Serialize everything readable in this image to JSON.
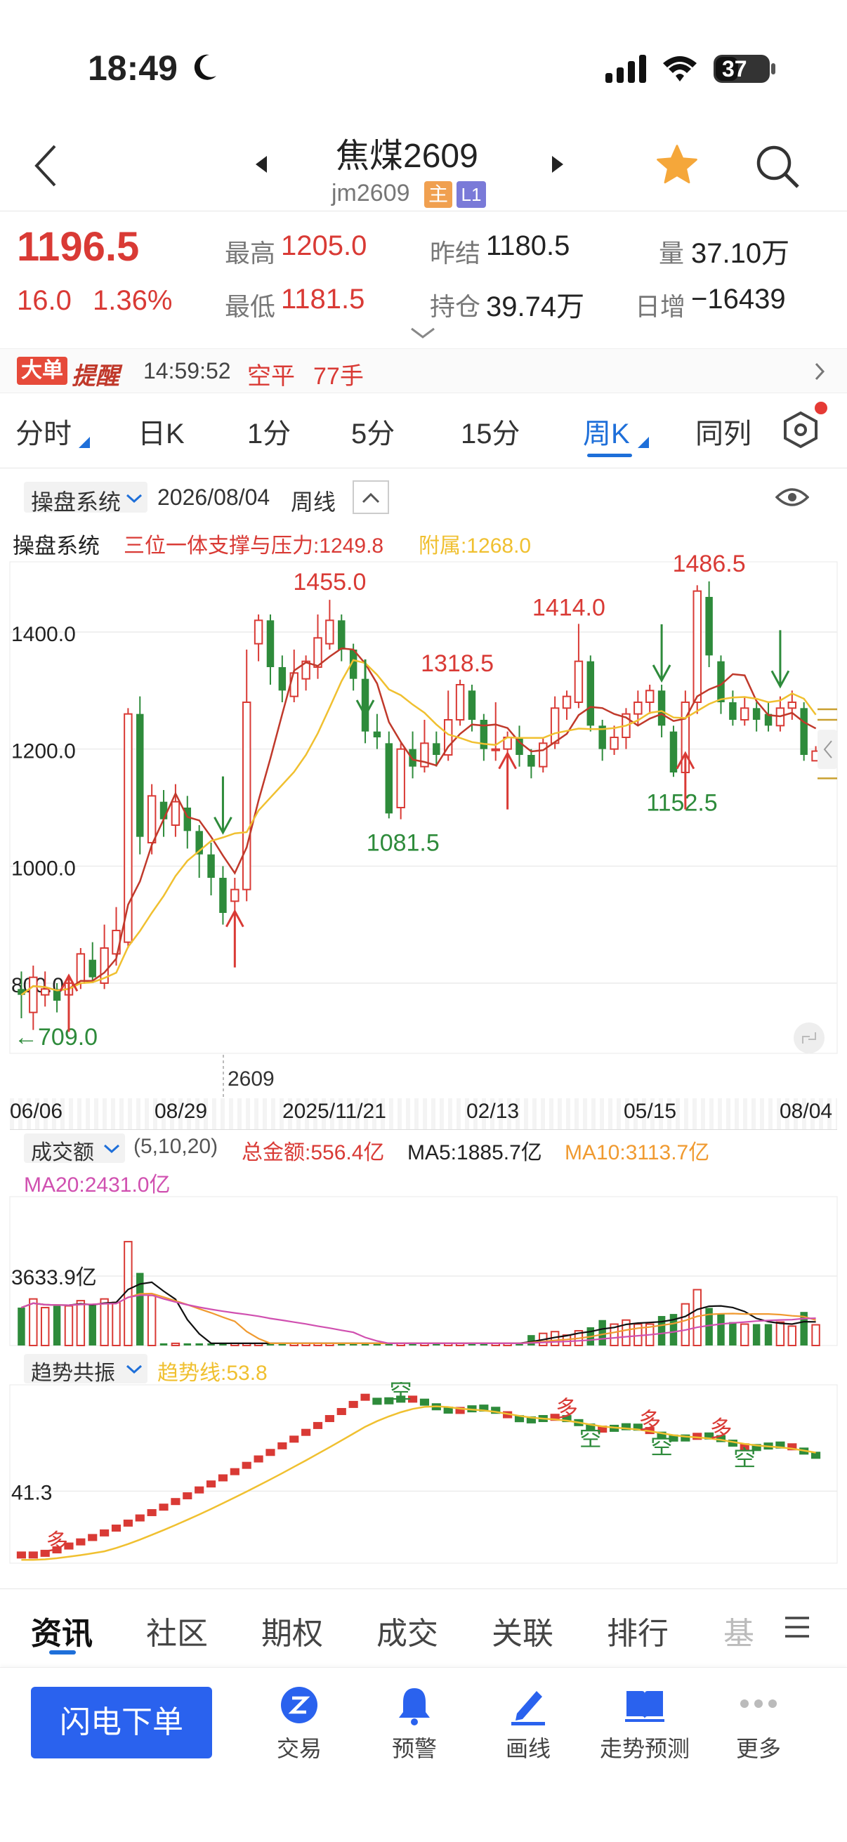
{
  "status_bar": {
    "time": "18:49",
    "battery": "37"
  },
  "header": {
    "title": "焦煤2609",
    "code": "jm2609",
    "badge_main": "主",
    "badge_level": "L1"
  },
  "quote": {
    "last": "1196.5",
    "change": "16.0",
    "change_pct": "1.36%",
    "high_label": "最高",
    "high": "1205.0",
    "low_label": "最低",
    "low": "1181.5",
    "prev_label": "昨结",
    "prev": "1180.5",
    "oi_label": "持仓",
    "oi": "39.74万",
    "vol_label": "量",
    "vol": "37.10万",
    "daily_inc_label": "日增",
    "daily_inc": "−16439"
  },
  "alert": {
    "badge_1": "大单",
    "badge_2": "提醒",
    "time": "14:59:52",
    "type": "空平",
    "qty": "77手"
  },
  "period_tabs": [
    {
      "label": "分时"
    },
    {
      "label": "日K"
    },
    {
      "label": "1分"
    },
    {
      "label": "5分"
    },
    {
      "label": "15分"
    },
    {
      "label": "周K"
    },
    {
      "label": "同列"
    }
  ],
  "indicator_bar": {
    "system": "操盘系统",
    "date": "2026/08/04",
    "period": "周线"
  },
  "main_legend": {
    "name": "操盘系统",
    "support": "三位一体支撑与压力:1249.8",
    "attach": "附属:1268.0"
  },
  "colors": {
    "up": "#d93a35",
    "down": "#2e8b3b",
    "yellow": "#f0c030",
    "accent": "#1e6fd9",
    "pink": "#d050b0",
    "orange": "#f09a30"
  },
  "chart_data": {
    "type": "candlestick",
    "y_ticks": [
      "1400.0",
      "1200.0",
      "1000.0",
      "800.0"
    ],
    "ylim": [
      680,
      1520
    ],
    "x_ticks": [
      "06/06",
      "08/29",
      "2025/11/21",
      "02/13",
      "05/15",
      "08/04"
    ],
    "contract_marker": "2609",
    "annotations": {
      "high_1": "1455.0",
      "high_2": "1318.5",
      "high_3": "1414.0",
      "high_4": "1486.5",
      "low_1": "1081.5",
      "low_2": "1152.5",
      "low_start": "←709.0"
    },
    "candles": [
      [
        790,
        780,
        820,
        740
      ],
      [
        750,
        810,
        830,
        720
      ],
      [
        780,
        790,
        820,
        760
      ],
      [
        790,
        770,
        800,
        750
      ],
      [
        780,
        800,
        810,
        760
      ],
      [
        800,
        850,
        860,
        790
      ],
      [
        840,
        810,
        870,
        800
      ],
      [
        800,
        860,
        900,
        790
      ],
      [
        850,
        890,
        930,
        830
      ],
      [
        870,
        1260,
        1270,
        860
      ],
      [
        1260,
        1050,
        1290,
        1020
      ],
      [
        1040,
        1120,
        1140,
        1020
      ],
      [
        1110,
        1080,
        1130,
        1050
      ],
      [
        1070,
        1110,
        1140,
        1050
      ],
      [
        1100,
        1060,
        1120,
        1030
      ],
      [
        1060,
        1020,
        1070,
        980
      ],
      [
        1020,
        980,
        1040,
        950
      ],
      [
        980,
        920,
        1000,
        900
      ],
      [
        940,
        960,
        980,
        920
      ],
      [
        960,
        1280,
        1370,
        940
      ],
      [
        1380,
        1420,
        1430,
        1350
      ],
      [
        1420,
        1340,
        1430,
        1310
      ],
      [
        1340,
        1300,
        1360,
        1280
      ],
      [
        1290,
        1330,
        1370,
        1280
      ],
      [
        1320,
        1350,
        1360,
        1300
      ],
      [
        1340,
        1390,
        1430,
        1320
      ],
      [
        1380,
        1420,
        1455,
        1370
      ],
      [
        1420,
        1370,
        1430,
        1350
      ],
      [
        1370,
        1320,
        1380,
        1300
      ],
      [
        1320,
        1230,
        1340,
        1210
      ],
      [
        1230,
        1220,
        1260,
        1200
      ],
      [
        1210,
        1090,
        1230,
        1081.5
      ],
      [
        1100,
        1200,
        1210,
        1080
      ],
      [
        1200,
        1170,
        1230,
        1150
      ],
      [
        1170,
        1210,
        1250,
        1160
      ],
      [
        1210,
        1190,
        1230,
        1170
      ],
      [
        1190,
        1250,
        1300,
        1180
      ],
      [
        1250,
        1310,
        1318.5,
        1240
      ],
      [
        1300,
        1250,
        1310,
        1230
      ],
      [
        1250,
        1200,
        1260,
        1180
      ],
      [
        1200,
        1200,
        1280,
        1180
      ],
      [
        1200,
        1220,
        1230,
        1190
      ],
      [
        1220,
        1190,
        1240,
        1170
      ],
      [
        1190,
        1170,
        1200,
        1150
      ],
      [
        1170,
        1210,
        1220,
        1160
      ],
      [
        1210,
        1270,
        1290,
        1200
      ],
      [
        1270,
        1290,
        1300,
        1250
      ],
      [
        1280,
        1350,
        1414,
        1270
      ],
      [
        1350,
        1240,
        1360,
        1230
      ],
      [
        1240,
        1200,
        1250,
        1180
      ],
      [
        1200,
        1220,
        1240,
        1190
      ],
      [
        1220,
        1260,
        1270,
        1200
      ],
      [
        1260,
        1280,
        1300,
        1240
      ],
      [
        1280,
        1300,
        1310,
        1260
      ],
      [
        1300,
        1240,
        1310,
        1220
      ],
      [
        1230,
        1160,
        1240,
        1152.5
      ],
      [
        1160,
        1280,
        1300,
        1150
      ],
      [
        1280,
        1470,
        1480,
        1260
      ],
      [
        1460,
        1360,
        1486.5,
        1340
      ],
      [
        1350,
        1280,
        1360,
        1260
      ],
      [
        1280,
        1250,
        1300,
        1240
      ],
      [
        1250,
        1270,
        1290,
        1240
      ],
      [
        1270,
        1250,
        1280,
        1230
      ],
      [
        1260,
        1240,
        1280,
        1230
      ],
      [
        1240,
        1270,
        1290,
        1230
      ],
      [
        1270,
        1280,
        1300,
        1250
      ],
      [
        1270,
        1190,
        1280,
        1180
      ],
      [
        1180,
        1196.5,
        1205,
        1181.5
      ]
    ]
  },
  "volume_legend": {
    "name": "成交额",
    "params": "(5,10,20)",
    "total": "总金额:556.4亿",
    "ma5": "MA5:1885.7亿",
    "ma10": "MA10:3113.7亿",
    "ma20": "MA20:2431.0亿",
    "tick": "3633.9亿"
  },
  "trend_legend": {
    "name": "趋势共振",
    "line": "趋势线:53.8",
    "tick": "41.3",
    "duo": "多",
    "kong": "空"
  },
  "bottom_tabs": [
    {
      "label": "资讯"
    },
    {
      "label": "社区"
    },
    {
      "label": "期权"
    },
    {
      "label": "成交"
    },
    {
      "label": "关联"
    },
    {
      "label": "排行"
    },
    {
      "label": "基"
    }
  ],
  "bottom_nav": {
    "order_button": "闪电下单",
    "items": [
      {
        "label": "交易"
      },
      {
        "label": "预警"
      },
      {
        "label": "画线"
      },
      {
        "label": "走势预测"
      },
      {
        "label": "更多"
      }
    ]
  }
}
